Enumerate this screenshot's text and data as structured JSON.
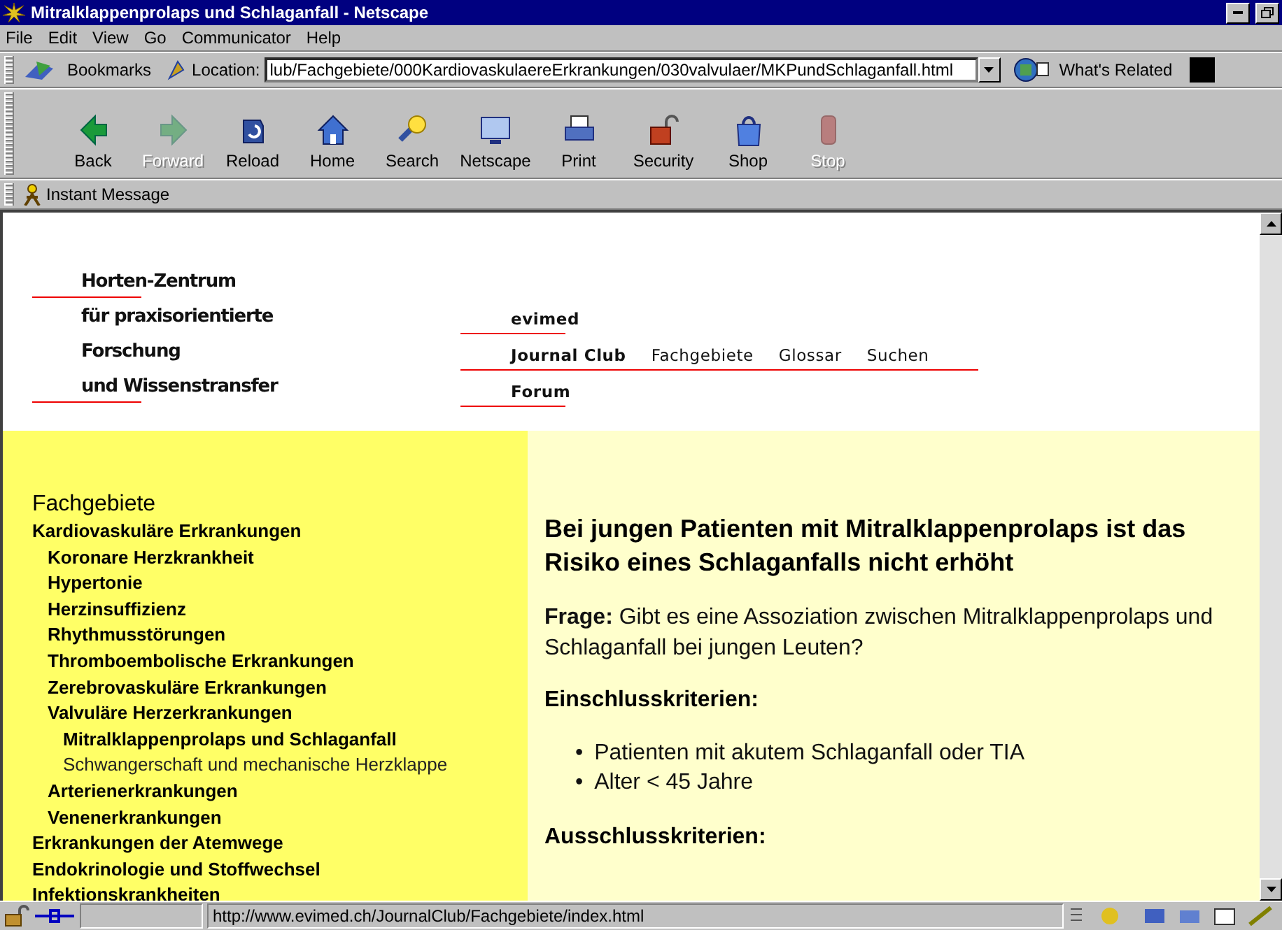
{
  "window": {
    "title": "Mitralklappenprolaps und Schlaganfall - Netscape"
  },
  "menu": [
    "File",
    "Edit",
    "View",
    "Go",
    "Communicator",
    "Help"
  ],
  "location_bar": {
    "bookmarks": "Bookmarks",
    "location_label": "Location:",
    "url": "lub/Fachgebiete/000KardiovaskulaereErkrankungen/030valvulaer/MKPundSchlaganfall.html",
    "related": "What's Related"
  },
  "toolbar": [
    {
      "label": "Back",
      "kind": "back",
      "disabled": false
    },
    {
      "label": "Forward",
      "kind": "forward",
      "disabled": true
    },
    {
      "label": "Reload",
      "kind": "reload",
      "disabled": false
    },
    {
      "label": "Home",
      "kind": "home",
      "disabled": false
    },
    {
      "label": "Search",
      "kind": "search",
      "disabled": false
    },
    {
      "label": "Netscape",
      "kind": "netscape",
      "disabled": false
    },
    {
      "label": "Print",
      "kind": "print",
      "disabled": false
    },
    {
      "label": "Security",
      "kind": "security",
      "disabled": false
    },
    {
      "label": "Shop",
      "kind": "shop",
      "disabled": false
    },
    {
      "label": "Stop",
      "kind": "stop",
      "disabled": true
    }
  ],
  "personal_toolbar": {
    "label": "Instant Message"
  },
  "header": {
    "institute": [
      "Horten-Zentrum",
      "für praxisorientierte",
      "Forschung",
      "und Wissenstransfer"
    ],
    "nav_rows": [
      {
        "links": [
          {
            "label": "evimed",
            "bold": true
          }
        ]
      },
      {
        "links": [
          {
            "label": "Journal Club",
            "bold": true
          },
          {
            "label": "Fachgebiete",
            "bold": false
          },
          {
            "label": "Glossar",
            "bold": false
          },
          {
            "label": "Suchen",
            "bold": false
          }
        ]
      },
      {
        "links": [
          {
            "label": "Forum",
            "bold": true
          }
        ]
      }
    ]
  },
  "sidebar": {
    "title": "Fachgebiete",
    "items": [
      {
        "label": "Kardiovaskuläre Erkrankungen",
        "bold": true,
        "children": [
          {
            "label": "Koronare Herzkrankheit",
            "bold": true
          },
          {
            "label": "Hypertonie",
            "bold": true
          },
          {
            "label": "Herzinsuffizienz",
            "bold": true
          },
          {
            "label": "Rhythmusstörungen",
            "bold": true
          },
          {
            "label": "Thromboembolische Erkrankungen",
            "bold": true
          },
          {
            "label": "Zerebrovaskuläre Erkrankungen",
            "bold": true
          },
          {
            "label": "Valvuläre Herzerkrankungen",
            "bold": true,
            "children": [
              {
                "label": "Mitralklappenprolaps und Schlaganfall",
                "bold": true
              },
              {
                "label": "Schwangerschaft und mechanische Herzklappe",
                "bold": false
              }
            ]
          },
          {
            "label": "Arterienerkrankungen",
            "bold": true
          },
          {
            "label": "Venenerkrankungen",
            "bold": true
          }
        ]
      },
      {
        "label": "Erkrankungen der Atemwege",
        "bold": true
      },
      {
        "label": "Endokrinologie und Stoffwechsel",
        "bold": true
      },
      {
        "label": "Infektionskrankheiten",
        "bold": true
      }
    ]
  },
  "article": {
    "title": "Bei jungen Patienten mit Mitralklappenprolaps ist das Risiko eines Schlaganfalls nicht erhöht",
    "question": "**Frage:** Gibt es eine Assoziation zwischen Mitralklappenprolaps und Schlaganfall bei jungen Leuten?",
    "sections": [
      {
        "heading": "Einschlusskriterien:",
        "marker": "•",
        "bullets": [
          "Patienten mit akutem Schlaganfall oder TIA",
          "Alter < 45 Jahre"
        ]
      },
      {
        "heading": "Ausschlusskriterien:"
      }
    ]
  },
  "status_bar": {
    "url": "http://www.evimed.ch/JournalClub/Fachgebiete/index.html"
  }
}
